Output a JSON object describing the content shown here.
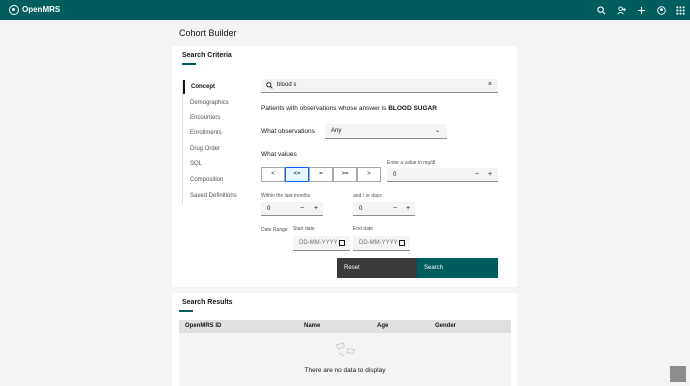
{
  "header": {
    "brand": "OpenMRS"
  },
  "page_title": "Cohort Builder",
  "criteria": {
    "title": "Search Criteria",
    "sidebar": [
      "Concept",
      "Demographics",
      "Encounters",
      "Enrollments",
      "Drug Order",
      "SQL",
      "Composition",
      "Saved Definitions"
    ],
    "search_value": "blood s",
    "prompt_prefix": "Patients with observations whose answer is",
    "prompt_value": "BLOOD SUGAR",
    "what_obs_label": "What observations",
    "what_obs_value": "Any",
    "what_values_label": "What values",
    "operators": [
      "<",
      "<=",
      "=",
      ">=",
      ">"
    ],
    "enter_value_label": "Enter a value in mg/dl",
    "value": "0",
    "within_label": "Within the last months",
    "within_value": "0",
    "days_label": "and / or days",
    "days_value": "0",
    "date_range_label": "Date Range",
    "start_label": "Start date",
    "start_placeholder": "DD-MM-YYYY",
    "end_label": "End date",
    "end_placeholder": "DD-MM-YYYY",
    "reset": "Reset",
    "search": "Search"
  },
  "results": {
    "title": "Search Results",
    "columns": [
      "OpenMRS ID",
      "Name",
      "Age",
      "Gender"
    ],
    "empty": "There are no data to display"
  },
  "colors": {
    "brand": "#005d5d",
    "dark_button": "#393939"
  }
}
